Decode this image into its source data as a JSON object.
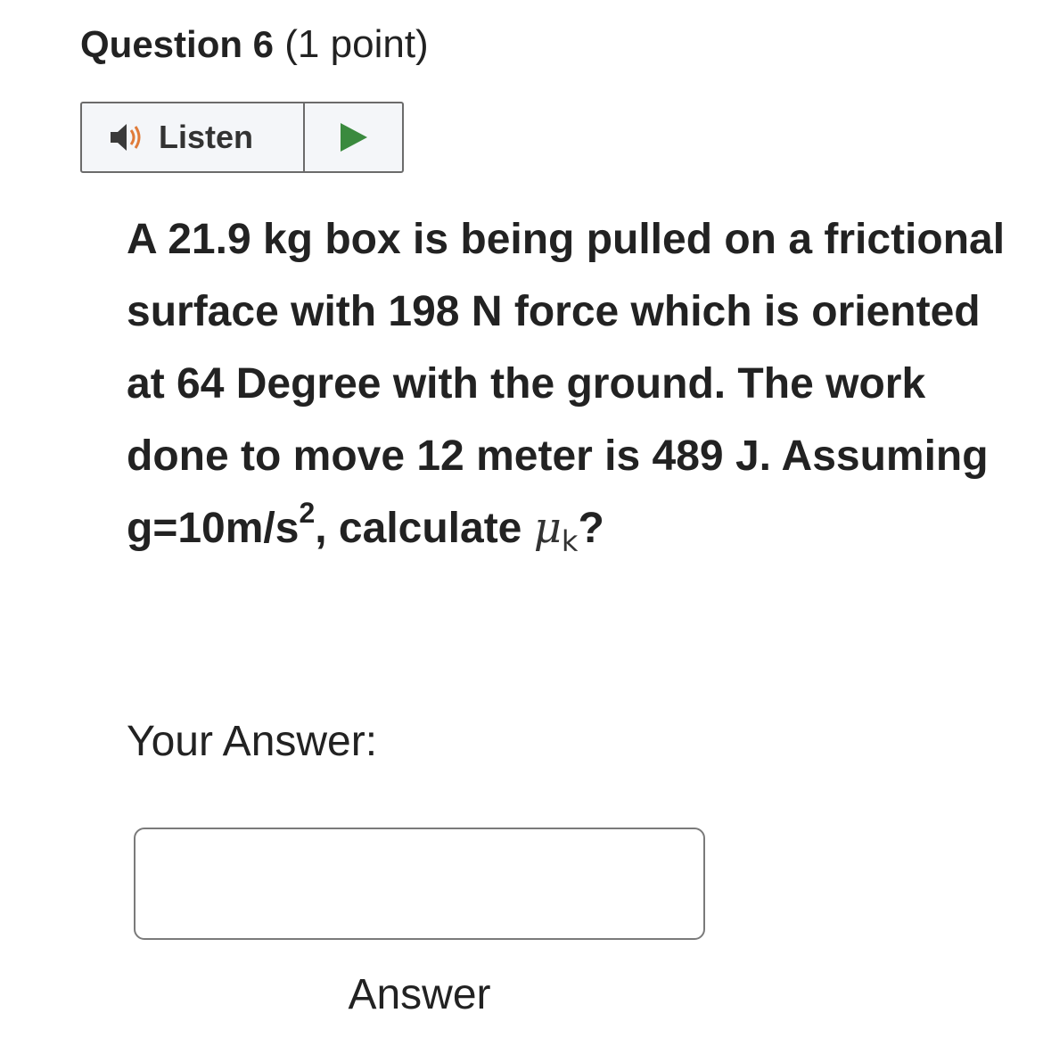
{
  "question": {
    "number_label": "Question 6",
    "points": "(1 point)"
  },
  "listen": {
    "label": "Listen",
    "speaker_icon": "speaker-icon",
    "play_icon": "play-icon",
    "speaker_color": "#e07b39",
    "play_color": "#3a8a3e"
  },
  "body": {
    "text_main": "A 21.9 kg box is being pulled on a frictional surface with 198 N force which is oriented at 64 Degree with the ground. The work done to move 12 meter is 489 J. Assuming g=10m/s",
    "exponent": "2",
    "text_after": ", calculate ",
    "mu_symbol": "μ",
    "mu_subscript": "k",
    "question_mark": "?"
  },
  "answer": {
    "label": "Your Answer:",
    "value": "",
    "caption": "Answer"
  }
}
